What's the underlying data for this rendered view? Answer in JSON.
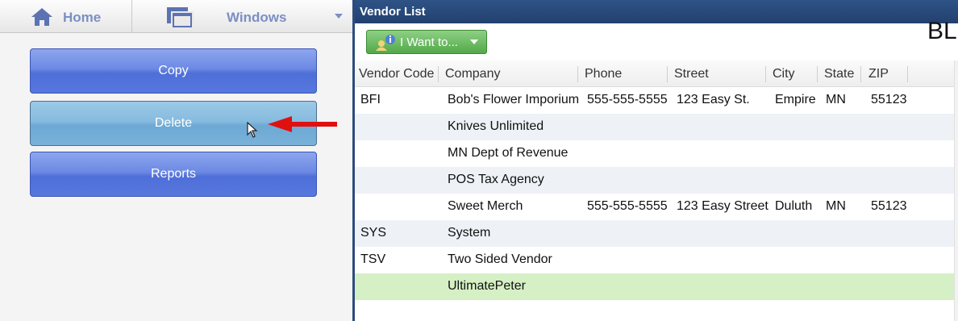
{
  "nav": {
    "home_label": "Home",
    "windows_label": "Windows"
  },
  "actions": {
    "copy": "Copy",
    "delete": "Delete",
    "reports": "Reports"
  },
  "panel": {
    "title": "Vendor List",
    "i_want_label": "I Want to...",
    "edge_text": "BL"
  },
  "grid": {
    "headers": [
      "Vendor Code",
      "Company",
      "Phone",
      "Street",
      "City",
      "State",
      "ZIP"
    ],
    "rows": [
      [
        "BFI",
        "Bob's Flower Imporium",
        "555-555-5555",
        "123 Easy St.",
        "Empire",
        "MN",
        "55123"
      ],
      [
        "",
        "Knives Unlimited",
        "",
        "",
        "",
        "",
        ""
      ],
      [
        "",
        "MN Dept of Revenue",
        "",
        "",
        "",
        "",
        ""
      ],
      [
        "",
        "POS Tax Agency",
        "",
        "",
        "",
        "",
        ""
      ],
      [
        "",
        "Sweet Merch",
        "555-555-5555",
        "123 Easy Street",
        "Duluth",
        "MN",
        "55123"
      ],
      [
        "SYS",
        "System",
        "",
        "",
        "",
        "",
        ""
      ],
      [
        "TSV",
        "Two Sided Vendor",
        "",
        "",
        "",
        "",
        ""
      ],
      [
        "",
        "UltimatePeter",
        "",
        "",
        "",
        "",
        ""
      ]
    ]
  },
  "colors": {
    "title_bar": "#2a4a7c",
    "button_blue": "#5b7de0",
    "button_active": "#7fb6dc",
    "selected_row": "#d5f0c5",
    "green_button": "#5cb251",
    "annotation_arrow": "#e01010"
  }
}
